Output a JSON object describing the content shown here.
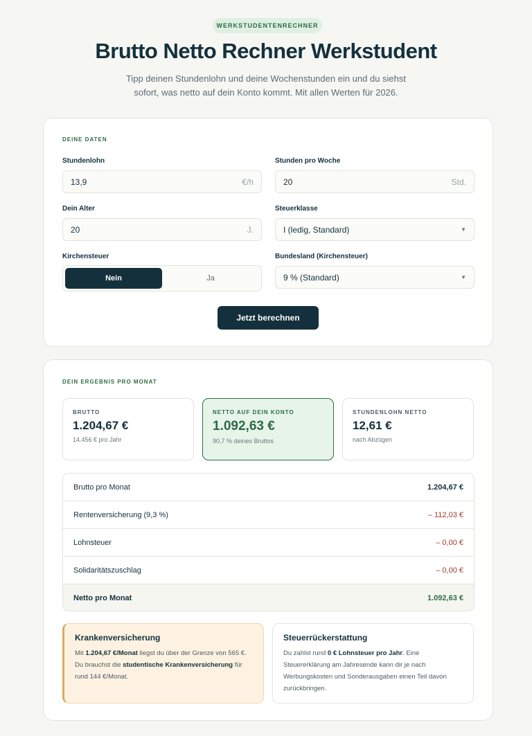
{
  "header": {
    "badge": "WERKSTUDENTENRECHNER",
    "title": "Brutto Netto Rechner Werkstudent",
    "subtitle": "Tipp deinen Stundenlohn und deine Wochenstunden ein und du siehst sofort, was netto auf dein Konto kommt. Mit allen Werten für 2026."
  },
  "form": {
    "section_label": "DEINE DATEN",
    "stundenlohn": {
      "label": "Stundenlohn",
      "value": "13,9",
      "unit": "€/h"
    },
    "stunden": {
      "label": "Stunden pro Woche",
      "value": "20",
      "unit": "Std."
    },
    "alter": {
      "label": "Dein Alter",
      "value": "20",
      "unit": "J."
    },
    "steuerklasse": {
      "label": "Steuerklasse",
      "value": "I (ledig, Standard)"
    },
    "kirchensteuer": {
      "label": "Kirchensteuer",
      "options": [
        "Nein",
        "Ja"
      ],
      "selected": "Nein"
    },
    "bundesland": {
      "label": "Bundesland (Kirchensteuer)",
      "value": "9 % (Standard)"
    },
    "submit_label": "Jetzt berechnen"
  },
  "result": {
    "section_label": "DEIN ERGEBNIS PRO MONAT",
    "cards": [
      {
        "label": "BRUTTO",
        "value": "1.204,67 €",
        "sub": "14.456 € pro Jahr"
      },
      {
        "label": "NETTO AUF DEIN KONTO",
        "value": "1.092,63 €",
        "sub": "90,7 % deines Bruttos"
      },
      {
        "label": "STUNDENLOHN NETTO",
        "value": "12,61 €",
        "sub": "nach Abzügen"
      }
    ],
    "breakdown": [
      {
        "label": "Brutto pro Monat",
        "amount": "1.204,67 €"
      },
      {
        "label": "Rentenversicherung (9,3 %)",
        "amount": "– 112,03 €"
      },
      {
        "label": "Lohnsteuer",
        "amount": "– 0,00 €"
      },
      {
        "label": "Solidaritätszuschlag",
        "amount": "– 0,00 €"
      },
      {
        "label": "Netto pro Monat",
        "amount": "1.092,63 €"
      }
    ]
  },
  "info": {
    "kv": {
      "title": "Krankenversicherung",
      "t1": "Mit ",
      "b1": "1.204,67 €/Monat",
      "t2": " liegst du über der Grenze von 565 €. Du brauchst die ",
      "b2": "studentische Krankenversicherung",
      "t3": " für rund 144 €/Monat."
    },
    "steuer": {
      "title": "Steuerrückerstattung",
      "t1": "Du zahlst rund ",
      "b1": "0 € Lohnsteuer pro Jahr",
      "t2": ". Eine Steuererklärung am Jahresende kann dir je nach Werbungskosten und Sonderausgaben einen Teil davon zurückbringen."
    }
  },
  "colors": {
    "primary": "#14303d",
    "accent_green": "#2f6b44",
    "negative_red": "#a33a2a",
    "warning_bg": "#fdf2e1",
    "page_bg": "#f6f6f3"
  }
}
